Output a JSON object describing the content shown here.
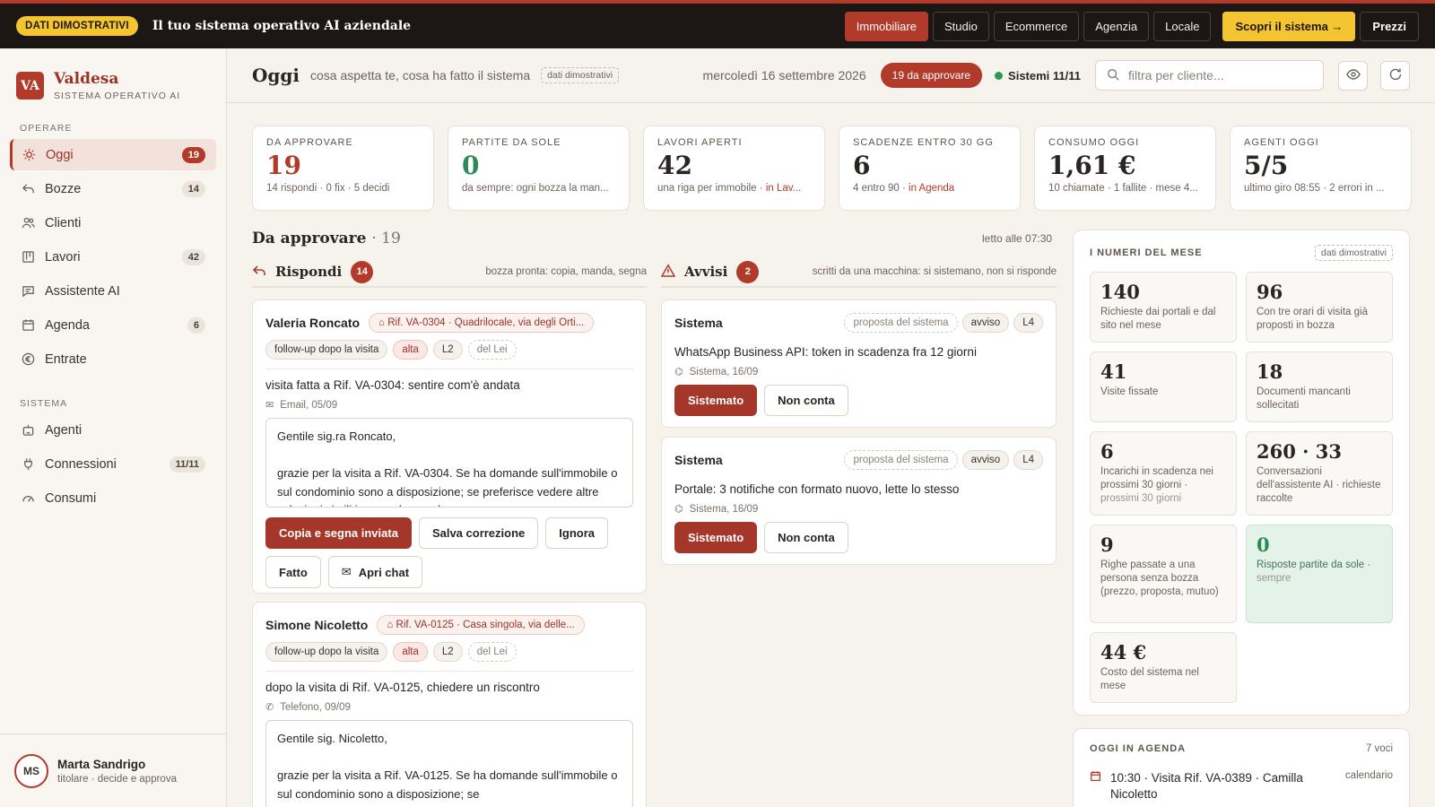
{
  "topbar": {
    "badge": "DATI DIMOSTRATIVI",
    "tagline": "Il tuo sistema operativo AI aziendale",
    "tabs": [
      "Immobiliare",
      "Studio",
      "Ecommerce",
      "Agenzia",
      "Locale"
    ],
    "cta": "Scopri il sistema →",
    "prezzi": "Prezzi"
  },
  "brand": {
    "logo": "VA",
    "name": "Valdesa",
    "sub": "SISTEMA OPERATIVO AI"
  },
  "sidebar": {
    "section1": "OPERARE",
    "section2": "SISTEMA",
    "items": [
      {
        "label": "Oggi",
        "count": "19"
      },
      {
        "label": "Bozze",
        "count": "14"
      },
      {
        "label": "Clienti",
        "count": ""
      },
      {
        "label": "Lavori",
        "count": "42"
      },
      {
        "label": "Assistente AI",
        "count": ""
      },
      {
        "label": "Agenda",
        "count": "6"
      },
      {
        "label": "Entrate",
        "count": ""
      },
      {
        "label": "Agenti",
        "count": ""
      },
      {
        "label": "Connessioni",
        "count": "11/11"
      },
      {
        "label": "Consumi",
        "count": ""
      }
    ]
  },
  "user": {
    "initials": "MS",
    "name": "Marta Sandrigo",
    "role": "titolare · decide e approva"
  },
  "header": {
    "title": "Oggi",
    "subtitle": "cosa aspetta te, cosa ha fatto il sistema",
    "demo": "dati dimostrativi",
    "date": "mercoledì 16 settembre 2026",
    "badge": "19 da approvare",
    "systems": "Sistemi 11/11",
    "search_placeholder": "filtra per cliente..."
  },
  "kpis": [
    {
      "label": "DA APPROVARE",
      "value": "19",
      "desc": "14 rispondi · 0 fix · 5 decidi",
      "link": ""
    },
    {
      "label": "PARTITE DA SOLE",
      "value": "0",
      "desc": "da sempre: ogni bozza la man...",
      "link": ""
    },
    {
      "label": "LAVORI APERTI",
      "value": "42",
      "desc": "una riga per immobile · ",
      "link": "in Lav..."
    },
    {
      "label": "SCADENZE ENTRO 30 GG",
      "value": "6",
      "desc": "4 entro 90 · ",
      "link": "in Agenda"
    },
    {
      "label": "CONSUMO OGGI",
      "value": "1,61 €",
      "desc": "10 chiamate · 1 fallite · mese 4...",
      "link": ""
    },
    {
      "label": "AGENTI OGGI",
      "value": "5/5",
      "desc": "ultimo giro 08:55 · 2 errori in ...",
      "link": ""
    }
  ],
  "section": {
    "title": "Da approvare",
    "count": "· 19",
    "read_at": "letto alle 07:30"
  },
  "rispondi": {
    "title": "Rispondi",
    "count": "14",
    "hint": "bozza pronta: copia, manda, segna"
  },
  "avvisi": {
    "title": "Avvisi",
    "count": "2",
    "hint": "scritti da una macchina: si sistemano, non si risponde"
  },
  "replies": [
    {
      "name": "Valeria Roncato",
      "ref": "Rif. VA-0304 · Quadrilocale, via degli Orti...",
      "chips": [
        "follow-up dopo la visita",
        "alta",
        "L2",
        "del Lei"
      ],
      "text": "visita fatta a Rif. VA-0304: sentire com'è andata",
      "meta": "Email, 05/09",
      "draft": "Gentile sig.ra Roncato,\n\ngrazie per la visita a Rif. VA-0304. Se ha domande sull'immobile o sul condominio sono a disposizione; se preferisce vedere altre soluzioni simili in zona, le mando una",
      "buttons": [
        "Copia e segna inviata",
        "Salva correzione",
        "Ignora",
        "Fatto",
        "Apri chat"
      ]
    },
    {
      "name": "Simone Nicoletto",
      "ref": "Rif. VA-0125 · Casa singola, via delle...",
      "chips": [
        "follow-up dopo la visita",
        "alta",
        "L2",
        "del Lei"
      ],
      "text": "dopo la visita di Rif. VA-0125, chiedere un riscontro",
      "meta": "Telefono, 09/09",
      "draft": "Gentile sig. Nicoletto,\n\ngrazie per la visita a Rif. VA-0125. Se ha domande sull'immobile o sul condominio sono a disposizione; se"
    }
  ],
  "alerts": [
    {
      "name": "Sistema",
      "tags": [
        "proposta del sistema",
        "avviso",
        "L4"
      ],
      "text": "WhatsApp Business API: token in scadenza fra 12 giorni",
      "meta": "Sistema, 16/09",
      "buttons": [
        "Sistemato",
        "Non conta"
      ]
    },
    {
      "name": "Sistema",
      "tags": [
        "proposta del sistema",
        "avviso",
        "L4"
      ],
      "text": "Portale: 3 notifiche con formato nuovo, lette lo stesso",
      "meta": "Sistema, 16/09",
      "buttons": [
        "Sistemato",
        "Non conta"
      ]
    }
  ],
  "month": {
    "title": "I NUMERI DEL MESE",
    "demo": "dati dimostrativi",
    "stats": [
      {
        "value": "140",
        "label": "Richieste dai portali e dal sito nel mese",
        "extra": ""
      },
      {
        "value": "96",
        "label": "Con tre orari di visita già proposti in bozza",
        "extra": ""
      },
      {
        "value": "41",
        "label": "Visite fissate",
        "extra": ""
      },
      {
        "value": "18",
        "label": "Documenti mancanti sollecitati",
        "extra": ""
      },
      {
        "value": "6",
        "label": "Incarichi in scadenza nei prossimi 30 giorni ·",
        "extra": "prossimi 30 giorni"
      },
      {
        "value": "260 · 33",
        "label": "Conversazioni dell'assistente AI · richieste raccolte",
        "extra": ""
      },
      {
        "value": "9",
        "label": "Righe passate a una persona senza bozza (prezzo, proposta, mutuo)",
        "extra": ""
      },
      {
        "value": "0",
        "label": "Risposte partite da sole ·",
        "extra": "sempre"
      },
      {
        "value": "44 €",
        "label": "Costo del sistema nel mese",
        "extra": ""
      }
    ]
  },
  "agenda": {
    "title": "OGGI IN AGENDA",
    "count": "7 voci",
    "rows": [
      {
        "text": "10:30 · Visita Rif. VA-0389 · Camilla Nicoletto",
        "kind": "calendario"
      }
    ]
  },
  "colors": {
    "accent": "#b23a2a",
    "topbar": "#1c1714",
    "cta": "#f4c531",
    "ok": "#2b9a5a"
  }
}
